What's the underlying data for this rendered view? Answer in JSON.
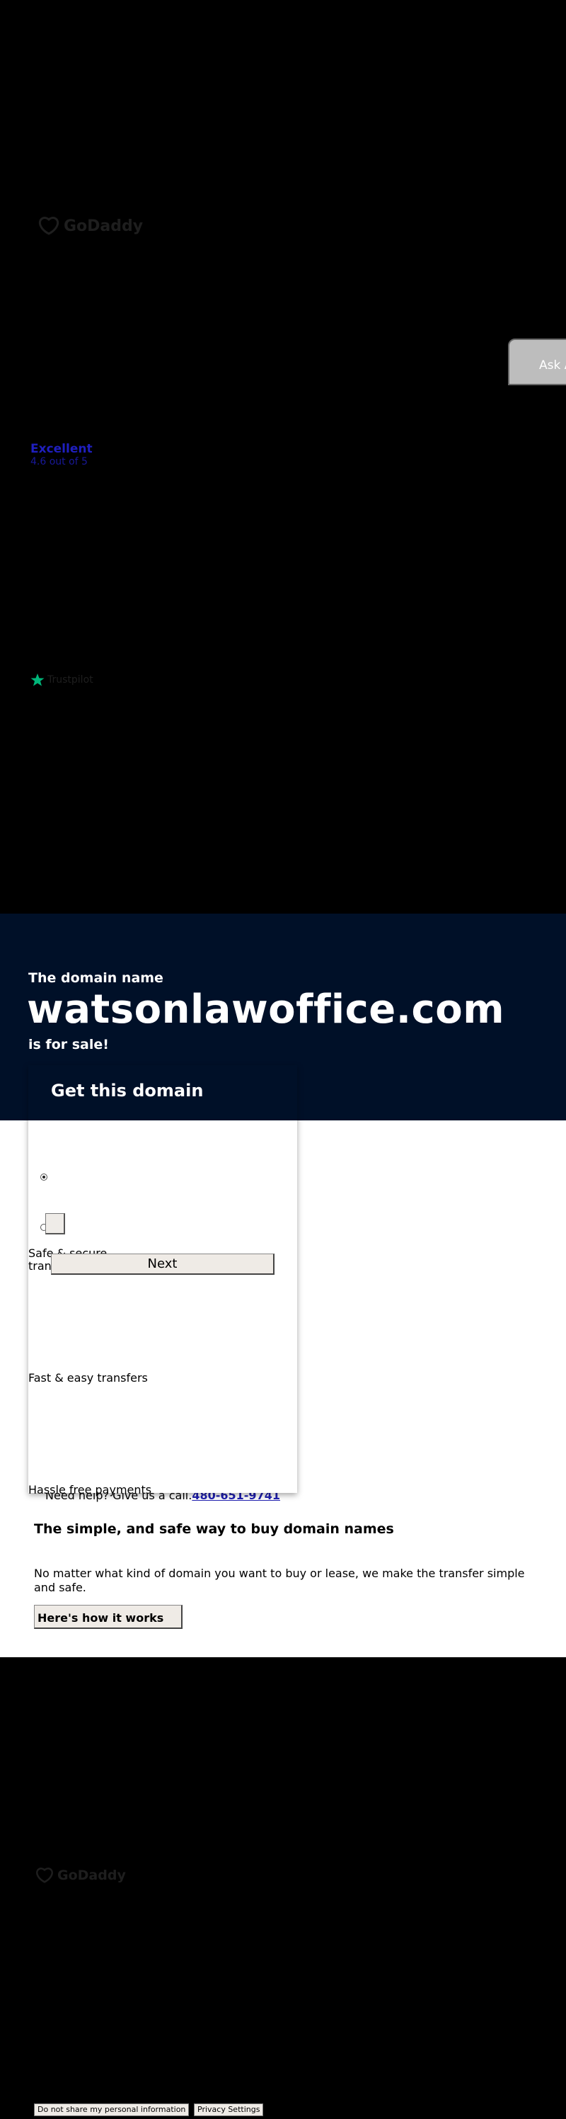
{
  "header": {
    "logo_text": "GoDaddy",
    "ask_button_label": "Ask A",
    "rating_label": "Excellent",
    "rating_score": "4.6 out of 5",
    "trustpilot_text": "Trustpilot"
  },
  "hero": {
    "pre_text": "The domain name",
    "domain": "watsonlawoffice.com",
    "post_text": "is for sale!"
  },
  "card": {
    "title": "Get this domain",
    "next_label": "Next",
    "features": [
      "Safe & secure transactions",
      "Fast & easy transfers",
      "Hassle free payments"
    ]
  },
  "help": {
    "text": "Need help? Give us a call.",
    "phone": "480-651-9741"
  },
  "info": {
    "title": "The simple, and safe way to buy domain names",
    "body": "No matter what kind of domain you want to buy or lease, we make the transfer simple and safe.",
    "button_label": "Here's how it works"
  },
  "footer": {
    "logo_text": "GoDaddy",
    "privacy_optout_label": "Do not share my personal information",
    "privacy_settings_label": "Privacy Settings"
  },
  "colors": {
    "hero_bg": "#001028",
    "link": "#1f1fb0",
    "trustpilot_star": "#00b67a"
  }
}
